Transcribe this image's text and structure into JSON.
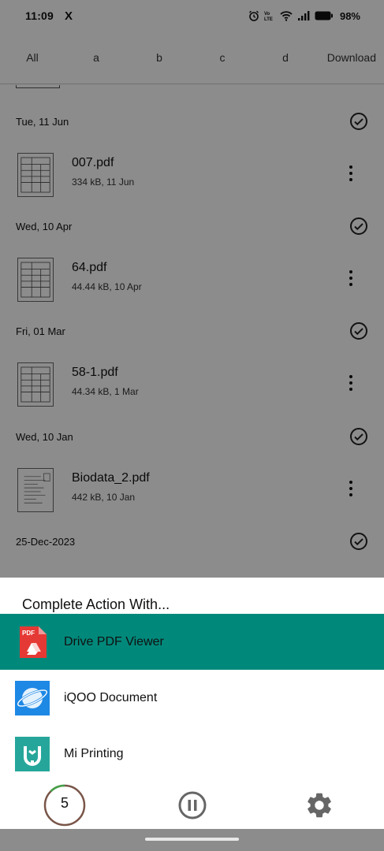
{
  "status_bar": {
    "time": "11:09",
    "x_label": "X",
    "battery": "98%"
  },
  "filter_tabs": [
    "All",
    "a",
    "b",
    "c",
    "d",
    "Download"
  ],
  "files": {
    "groups": [
      {
        "date": "Tue, 11 Jun",
        "name": "007.pdf",
        "meta": "334 kB, 11 Jun"
      },
      {
        "date": "Wed, 10 Apr",
        "name": "64.pdf",
        "meta": "44.44 kB, 10 Apr"
      },
      {
        "date": "Fri, 01 Mar",
        "name": "58-1.pdf",
        "meta": "44.34 kB, 1 Mar"
      },
      {
        "date": "Wed, 10 Jan",
        "name": "Biodata_2.pdf",
        "meta": "442 kB, 10 Jan"
      },
      {
        "date": "25-Dec-2023",
        "name": "",
        "meta": ""
      }
    ]
  },
  "sheet": {
    "title": "Complete Action With...",
    "apps": [
      {
        "label": "Drive PDF Viewer",
        "icon": "drive-pdf-viewer-icon",
        "color": "#e53935",
        "selected": true
      },
      {
        "label": "iQOO Document",
        "icon": "iqoo-document-icon",
        "color": "#1e88e5",
        "selected": false
      },
      {
        "label": "Mi Printing",
        "icon": "mi-printing-icon",
        "color": "#26a69a",
        "selected": false
      }
    ],
    "selected_color": "#00897b",
    "timer_value": "5",
    "icon_pdf_label": "PDF"
  }
}
